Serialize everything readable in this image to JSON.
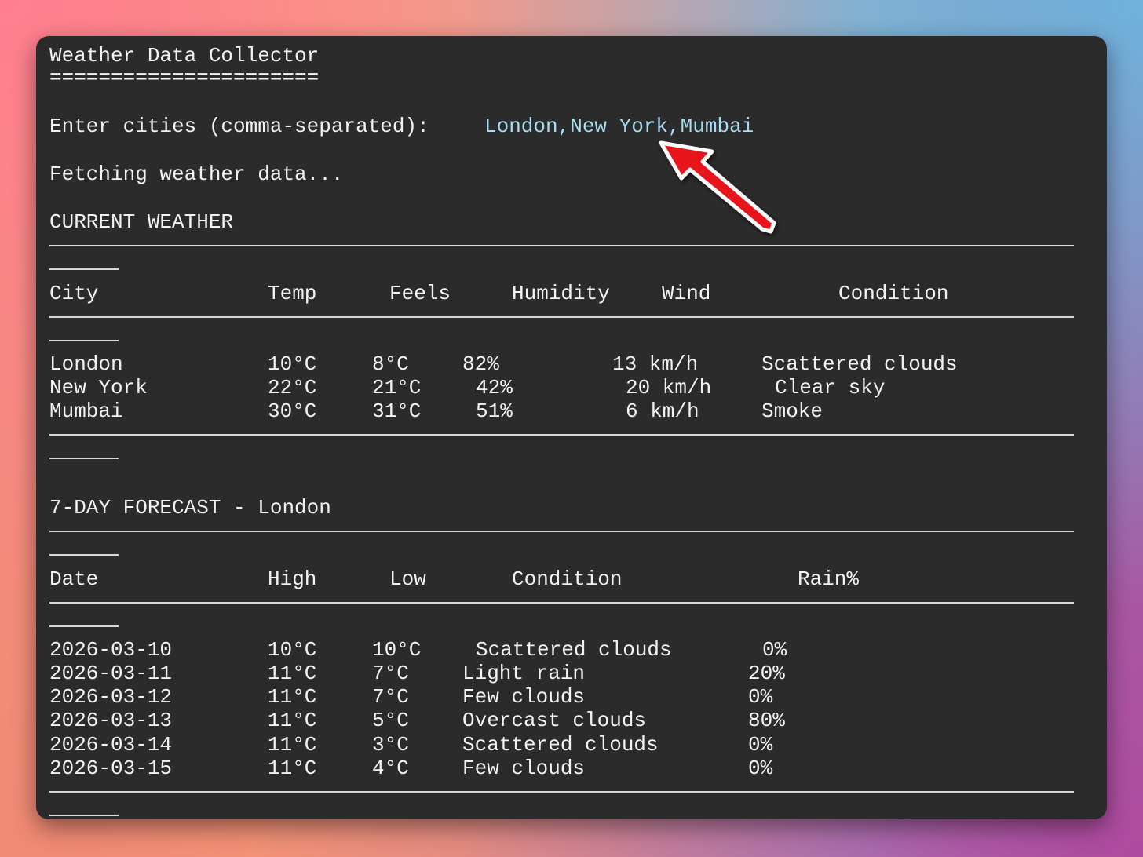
{
  "app": {
    "title": "Weather Data Collector",
    "title_underline": "======================"
  },
  "prompt": {
    "label": "Enter cities (comma-separated): ",
    "value": "London,New York,Mumbai"
  },
  "status": "Fetching weather data...",
  "current": {
    "heading": "CURRENT WEATHER",
    "headers": {
      "city": "City",
      "temp": "Temp",
      "feels": "Feels",
      "humidity": "Humidity",
      "wind": "Wind",
      "condition": "Condition"
    },
    "rows": [
      {
        "city": "London",
        "temp": "10°C",
        "feels": "8°C",
        "humidity": "82%",
        "wind": "13 km/h",
        "condition": "Scattered clouds"
      },
      {
        "city": "New York",
        "temp": "22°C",
        "feels": "21°C",
        "humidity": "42%",
        "wind": "20 km/h",
        "condition": "Clear sky"
      },
      {
        "city": "Mumbai",
        "temp": "30°C",
        "feels": "31°C",
        "humidity": "51%",
        "wind": "6 km/h",
        "condition": "Smoke"
      }
    ]
  },
  "forecast": {
    "heading": "7-DAY FORECAST - London",
    "headers": {
      "date": "Date",
      "high": "High",
      "low": "Low",
      "condition": "Condition",
      "rain": "Rain%"
    },
    "rows": [
      {
        "date": "2026-03-10",
        "high": "10°C",
        "low": "10°C",
        "condition": "Scattered clouds",
        "rain": "0%"
      },
      {
        "date": "2026-03-11",
        "high": "11°C",
        "low": "7°C",
        "condition": "Light rain",
        "rain": "20%"
      },
      {
        "date": "2026-03-12",
        "high": "11°C",
        "low": "7°C",
        "condition": "Few clouds",
        "rain": "0%"
      },
      {
        "date": "2026-03-13",
        "high": "11°C",
        "low": "5°C",
        "condition": "Overcast clouds",
        "rain": "80%"
      },
      {
        "date": "2026-03-14",
        "high": "11°C",
        "low": "3°C",
        "condition": "Scattered clouds",
        "rain": "0%"
      },
      {
        "date": "2026-03-15",
        "high": "11°C",
        "low": "4°C",
        "condition": "Few clouds",
        "rain": "0%"
      }
    ]
  },
  "annotation": {
    "icon": "red-arrow-icon",
    "color": "#e8171d"
  },
  "colors": {
    "terminal_bg": "#2b2b2b",
    "text": "#f2f2f2",
    "input_accent": "#a8dcf0"
  }
}
